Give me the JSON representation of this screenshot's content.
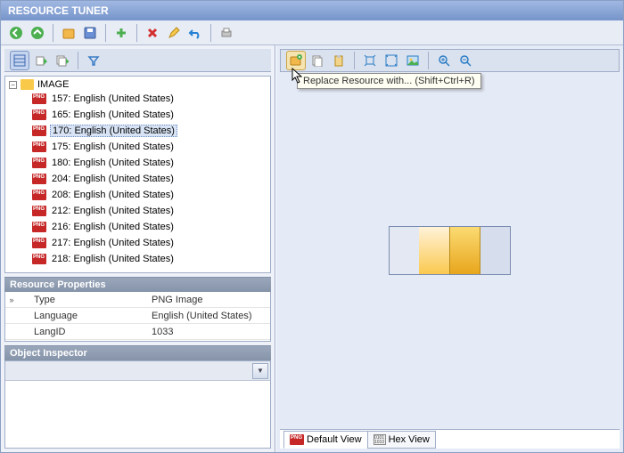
{
  "title": "RESOURCE TUNER",
  "tooltip": "Replace Resource with... (Shift+Ctrl+R)",
  "tree": {
    "root": "IMAGE",
    "items": [
      {
        "label": "157: English (United States)"
      },
      {
        "label": "165: English (United States)"
      },
      {
        "label": "170: English (United States)",
        "selected": true
      },
      {
        "label": "175: English (United States)"
      },
      {
        "label": "180: English (United States)"
      },
      {
        "label": "204: English (United States)"
      },
      {
        "label": "208: English (United States)"
      },
      {
        "label": "212: English (United States)"
      },
      {
        "label": "216: English (United States)"
      },
      {
        "label": "217: English (United States)"
      },
      {
        "label": "218: English (United States)"
      }
    ]
  },
  "panels": {
    "props_title": "Resource Properties",
    "inspector_title": "Object Inspector"
  },
  "props": [
    {
      "key": "Type",
      "val": "PNG Image"
    },
    {
      "key": "Language",
      "val": "English (United States)"
    },
    {
      "key": "LangID",
      "val": "1033"
    }
  ],
  "tabs": {
    "default": "Default View",
    "hex": "Hex View"
  }
}
